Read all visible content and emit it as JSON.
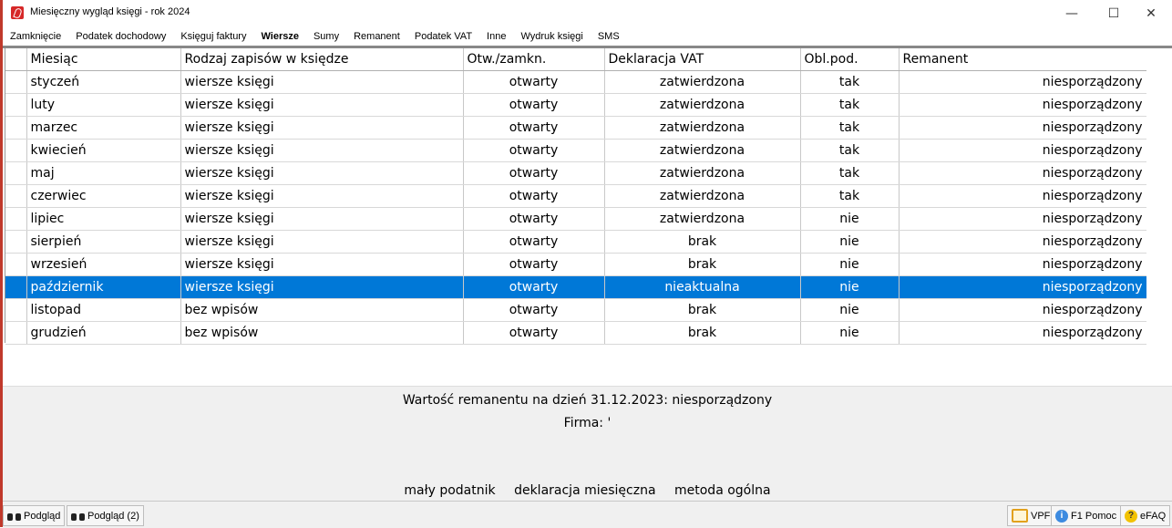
{
  "window": {
    "title": "Miesięczny wygląd księgi - rok 2024",
    "minimize_glyph": "—",
    "maximize_glyph": "☐",
    "close_glyph": "✕"
  },
  "menu": [
    {
      "label": "Zamknięcie",
      "bold": false
    },
    {
      "label": "Podatek dochodowy",
      "bold": false
    },
    {
      "label": "Księguj faktury",
      "bold": false
    },
    {
      "label": "Wiersze",
      "bold": true
    },
    {
      "label": "Sumy",
      "bold": false
    },
    {
      "label": "Remanent",
      "bold": false
    },
    {
      "label": "Podatek VAT",
      "bold": false
    },
    {
      "label": "Inne",
      "bold": false
    },
    {
      "label": "Wydruk księgi",
      "bold": false
    },
    {
      "label": "SMS",
      "bold": false
    }
  ],
  "grid": {
    "columns": [
      "Miesiąc",
      "Rodzaj zapisów w księdze",
      "Otw./zamkn.",
      "Deklaracja VAT",
      "Obl.pod.",
      "Remanent"
    ],
    "selected_index": 9,
    "rows": [
      [
        "styczeń",
        "wiersze księgi",
        "otwarty",
        "zatwierdzona",
        "tak",
        "niesporządzony"
      ],
      [
        "luty",
        "wiersze księgi",
        "otwarty",
        "zatwierdzona",
        "tak",
        "niesporządzony"
      ],
      [
        "marzec",
        "wiersze księgi",
        "otwarty",
        "zatwierdzona",
        "tak",
        "niesporządzony"
      ],
      [
        "kwiecień",
        "wiersze księgi",
        "otwarty",
        "zatwierdzona",
        "tak",
        "niesporządzony"
      ],
      [
        "maj",
        "wiersze księgi",
        "otwarty",
        "zatwierdzona",
        "tak",
        "niesporządzony"
      ],
      [
        "czerwiec",
        "wiersze księgi",
        "otwarty",
        "zatwierdzona",
        "tak",
        "niesporządzony"
      ],
      [
        "lipiec",
        "wiersze księgi",
        "otwarty",
        "zatwierdzona",
        "nie",
        "niesporządzony"
      ],
      [
        "sierpień",
        "wiersze księgi",
        "otwarty",
        "brak",
        "nie",
        "niesporządzony"
      ],
      [
        "wrzesień",
        "wiersze księgi",
        "otwarty",
        "brak",
        "nie",
        "niesporządzony"
      ],
      [
        "październik",
        "wiersze księgi",
        "otwarty",
        "nieaktualna",
        "nie",
        "niesporządzony"
      ],
      [
        "listopad",
        "bez wpisów",
        "otwarty",
        "brak",
        "nie",
        "niesporządzony"
      ],
      [
        "grudzień",
        "bez wpisów",
        "otwarty",
        "brak",
        "nie",
        "niesporządzony"
      ]
    ]
  },
  "info": {
    "remanent_line": "Wartość remanentu na dzień 31.12.2023:  niesporządzony",
    "firma_line": "Firma: '",
    "status_parts": [
      "mały podatnik",
      "deklaracja miesięczna",
      "metoda ogólna"
    ]
  },
  "statusbar": {
    "preview1": "Podgląd",
    "preview2": "Podgląd (2)",
    "vpf": "VPF",
    "help": "F1 Pomoc",
    "efaq": "eFAQ"
  }
}
